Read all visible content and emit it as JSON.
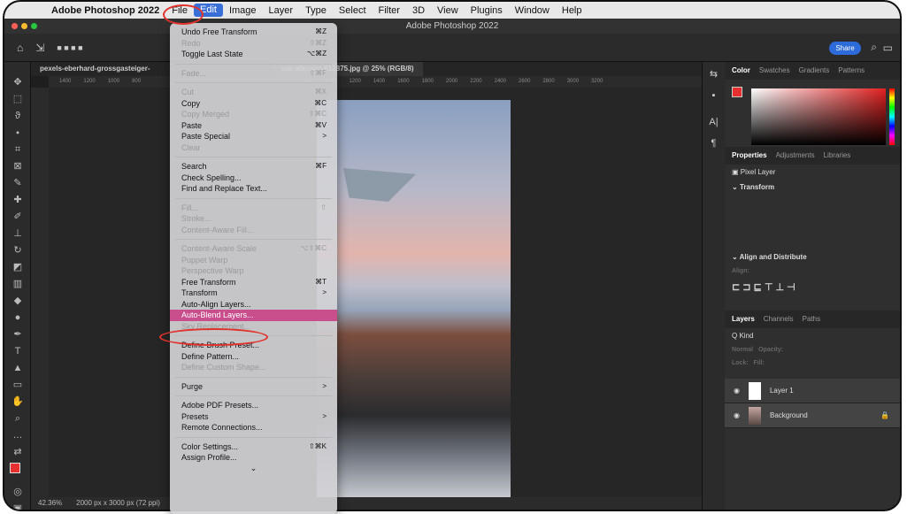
{
  "menubar": {
    "app": "Adobe Photoshop 2022",
    "items": [
      "File",
      "Edit",
      "Image",
      "Layer",
      "Type",
      "Select",
      "Filter",
      "3D",
      "View",
      "Plugins",
      "Window",
      "Help"
    ]
  },
  "title": "Adobe Photoshop 2022",
  "options": {
    "share": "Share"
  },
  "doc_tabs": [
    "pexels-eberhard-grossgasteiger-",
    "cas-allmann-612875.jpg @ 25% (RGB/8)"
  ],
  "ruler_ticks": [
    "1400",
    "1200",
    "1000",
    "800",
    "800",
    "1000",
    "1200",
    "1400",
    "1600",
    "1800",
    "2000",
    "2200",
    "2400",
    "2600",
    "2800",
    "3000",
    "3200"
  ],
  "status": {
    "zoom": "42.36%",
    "size": "2000 px x 3000 px (72 ppi)"
  },
  "edit_menu": {
    "g1": [
      {
        "label": "Undo Free Transform",
        "sc": "⌘Z",
        "dis": false
      },
      {
        "label": "Redo",
        "sc": "⇧⌘Z",
        "dis": true
      },
      {
        "label": "Toggle Last State",
        "sc": "⌥⌘Z",
        "dis": false
      }
    ],
    "g2": [
      {
        "label": "Fade...",
        "sc": "⇧⌘F",
        "dis": true
      }
    ],
    "g3": [
      {
        "label": "Cut",
        "sc": "⌘X",
        "dis": true
      },
      {
        "label": "Copy",
        "sc": "⌘C",
        "dis": false
      },
      {
        "label": "Copy Merged",
        "sc": "⇧⌘C",
        "dis": true
      },
      {
        "label": "Paste",
        "sc": "⌘V",
        "dis": false
      },
      {
        "label": "Paste Special",
        "sc": ">",
        "dis": false
      },
      {
        "label": "Clear",
        "sc": "",
        "dis": true
      }
    ],
    "g4": [
      {
        "label": "Search",
        "sc": "⌘F",
        "dis": false
      },
      {
        "label": "Check Spelling...",
        "sc": "",
        "dis": false
      },
      {
        "label": "Find and Replace Text...",
        "sc": "",
        "dis": false
      }
    ],
    "g5": [
      {
        "label": "Fill...",
        "sc": "⇧",
        "dis": true
      },
      {
        "label": "Stroke...",
        "sc": "",
        "dis": true
      },
      {
        "label": "Content-Aware Fill...",
        "sc": "",
        "dis": true
      }
    ],
    "g6": [
      {
        "label": "Content-Aware Scale",
        "sc": "⌥⇧⌘C",
        "dis": true
      },
      {
        "label": "Puppet Warp",
        "sc": "",
        "dis": true
      },
      {
        "label": "Perspective Warp",
        "sc": "",
        "dis": true
      },
      {
        "label": "Free Transform",
        "sc": "⌘T",
        "dis": false
      },
      {
        "label": "Transform",
        "sc": ">",
        "dis": false
      },
      {
        "label": "Auto-Align Layers...",
        "sc": "",
        "dis": false
      },
      {
        "label": "Auto-Blend Layers...",
        "sc": "",
        "dis": false,
        "hi": true
      },
      {
        "label": "Sky Replacement...",
        "sc": "",
        "dis": true
      }
    ],
    "g7": [
      {
        "label": "Define Brush Preset...",
        "sc": "",
        "dis": false
      },
      {
        "label": "Define Pattern...",
        "sc": "",
        "dis": false
      },
      {
        "label": "Define Custom Shape...",
        "sc": "",
        "dis": true
      }
    ],
    "g8": [
      {
        "label": "Purge",
        "sc": ">",
        "dis": false
      }
    ],
    "g9": [
      {
        "label": "Adobe PDF Presets...",
        "sc": "",
        "dis": false
      },
      {
        "label": "Presets",
        "sc": ">",
        "dis": false
      },
      {
        "label": "Remote Connections...",
        "sc": "",
        "dis": false
      }
    ],
    "g10": [
      {
        "label": "Color Settings...",
        "sc": "⇧⌘K",
        "dis": false
      },
      {
        "label": "Assign Profile...",
        "sc": "",
        "dis": false
      }
    ]
  },
  "panels": {
    "color_tabs": [
      "Color",
      "Swatches",
      "Gradients",
      "Patterns"
    ],
    "prop_tabs": [
      "Properties",
      "Adjustments",
      "Libraries"
    ],
    "pixel_layer": "Pixel Layer",
    "transform": "Transform",
    "align": "Align and Distribute",
    "align_label": "Align:",
    "layer_tabs": [
      "Layers",
      "Channels",
      "Paths"
    ],
    "kind": "Q Kind",
    "blend": "Normal",
    "opacity": "Opacity:",
    "lock": "Lock:",
    "fill": "Fill:",
    "layers": [
      "Layer 1",
      "Background"
    ]
  },
  "colors": {
    "accent": "#2d6bda",
    "highlight": "#c94f8c",
    "annotation": "#e0322b",
    "fg_swatch": "#e63030"
  }
}
